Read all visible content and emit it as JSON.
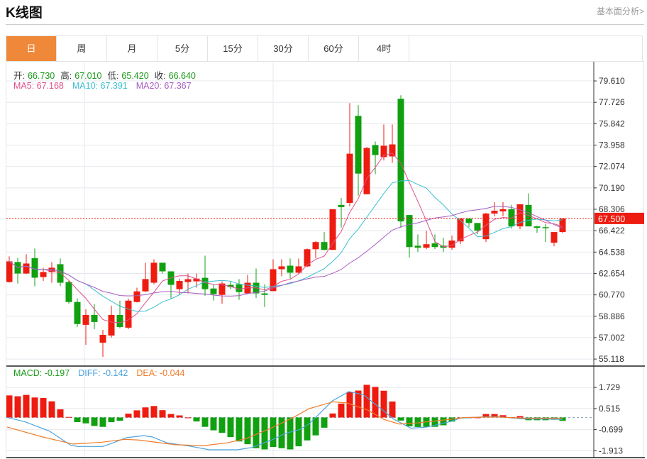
{
  "header": {
    "title": "K线图",
    "more_link": "基本面分析>"
  },
  "tabs": [
    {
      "label": "日",
      "active": true
    },
    {
      "label": "周"
    },
    {
      "label": "月"
    },
    {
      "label": "5分"
    },
    {
      "label": "15分"
    },
    {
      "label": "30分"
    },
    {
      "label": "60分"
    },
    {
      "label": "4时"
    }
  ],
  "ohlc_legend": {
    "open_label": "开:",
    "open": "66.730",
    "high_label": "高:",
    "high": "67.010",
    "low_label": "低:",
    "low": "65.420",
    "close_label": "收:",
    "close": "66.640"
  },
  "ma_legend": {
    "ma5": "MA5: 67.168",
    "ma10": "MA10: 67.391",
    "ma20": "MA20: 67.367"
  },
  "macd_legend": {
    "macd": "MACD: -0.197",
    "diff": "DIFF: -0.142",
    "dea": "DEA: -0.044"
  },
  "current_price": "67.500",
  "colors": {
    "up": "#ee1c10",
    "down": "#10a010",
    "accent": "#f0883a",
    "ma5": "#e0508a",
    "ma10": "#3bbfd0",
    "ma20": "#a85cc0",
    "diff": "#4aa3df",
    "dea": "#f07c2a",
    "macd_text": "#1a9a1a"
  },
  "chart_data": [
    {
      "type": "candlestick",
      "ylim": [
        54.5,
        81.3
      ],
      "y_ticks": [
        "79.610",
        "77.726",
        "75.842",
        "73.958",
        "72.074",
        "70.190",
        "68.306",
        "66.422",
        "64.538",
        "62.654",
        "60.770",
        "58.886",
        "57.002",
        "55.118"
      ],
      "grid": true,
      "current_price_line": 67.5,
      "ohlc": [
        [
          61.9,
          64.16,
          61.85,
          63.72
        ],
        [
          63.66,
          64.03,
          61.77,
          62.65
        ],
        [
          62.65,
          64.35,
          62.6,
          63.53
        ],
        [
          64.0,
          64.85,
          61.53,
          62.28
        ],
        [
          62.34,
          63.16,
          62.0,
          62.78
        ],
        [
          62.78,
          63.66,
          61.84,
          63.16
        ],
        [
          63.47,
          63.97,
          61.53,
          61.84
        ],
        [
          61.9,
          62.03,
          60.0,
          60.14
        ],
        [
          60.14,
          60.45,
          57.95,
          58.2
        ],
        [
          58.13,
          59.5,
          56.37,
          59.0
        ],
        [
          59.0,
          59.95,
          57.75,
          58.38
        ],
        [
          56.56,
          57.69,
          55.31,
          57.25
        ],
        [
          57.19,
          59.82,
          57.0,
          59.0
        ],
        [
          59.0,
          60.26,
          57.82,
          57.94
        ],
        [
          57.88,
          60.45,
          57.75,
          60.26
        ],
        [
          60.14,
          61.4,
          60.1,
          61.08
        ],
        [
          61.08,
          63.6,
          61.0,
          62.16
        ],
        [
          61.84,
          63.9,
          61.7,
          63.6
        ],
        [
          63.6,
          63.6,
          62.65,
          62.84
        ],
        [
          62.84,
          62.84,
          60.45,
          61.65
        ],
        [
          61.27,
          62.2,
          60.77,
          62.0
        ],
        [
          61.9,
          62.65,
          60.9,
          62.15
        ],
        [
          61.96,
          62.65,
          61.4,
          62.2
        ],
        [
          62.27,
          64.22,
          60.7,
          61.27
        ],
        [
          61.33,
          61.65,
          60.27,
          60.83
        ],
        [
          60.77,
          61.96,
          60.0,
          61.77
        ],
        [
          61.65,
          61.96,
          61.27,
          61.46
        ],
        [
          61.71,
          62.15,
          60.33,
          61.02
        ],
        [
          60.9,
          62.53,
          60.83,
          61.84
        ],
        [
          61.84,
          63.09,
          60.5,
          60.9
        ],
        [
          60.9,
          61.7,
          59.7,
          60.77
        ],
        [
          61.1,
          63.9,
          61.1,
          63.03
        ],
        [
          63.03,
          63.9,
          62.4,
          63.28
        ],
        [
          63.34,
          63.97,
          62.2,
          62.72
        ],
        [
          62.72,
          63.97,
          62.6,
          63.28
        ],
        [
          63.28,
          64.85,
          63.2,
          64.79
        ],
        [
          64.79,
          65.5,
          64.0,
          65.42
        ],
        [
          65.42,
          66.3,
          64.7,
          64.73
        ],
        [
          64.73,
          68.31,
          64.73,
          68.31
        ],
        [
          68.69,
          69.3,
          66.7,
          68.5
        ],
        [
          68.87,
          77.66,
          68.56,
          73.2
        ],
        [
          76.53,
          77.47,
          69.5,
          71.45
        ],
        [
          69.63,
          73.8,
          69.63,
          73.7
        ],
        [
          73.96,
          74.27,
          71.4,
          73.08
        ],
        [
          72.9,
          75.78,
          72.6,
          73.9
        ],
        [
          72.96,
          75.78,
          72.4,
          74.02
        ],
        [
          78.04,
          78.35,
          66.67,
          67.24
        ],
        [
          67.8,
          67.8,
          64.04,
          64.98
        ],
        [
          65.1,
          66.1,
          64.54,
          64.92
        ],
        [
          64.92,
          66.42,
          64.8,
          65.23
        ],
        [
          65.3,
          66.1,
          64.8,
          64.98
        ],
        [
          65.1,
          65.8,
          64.54,
          64.92
        ],
        [
          64.92,
          65.99,
          64.73,
          65.55
        ],
        [
          65.48,
          67.5,
          65.23,
          67.49
        ],
        [
          67.49,
          67.5,
          66.73,
          67.1
        ],
        [
          67.1,
          67.1,
          66.1,
          66.42
        ],
        [
          65.67,
          68.0,
          65.42,
          67.93
        ],
        [
          67.93,
          68.94,
          67.68,
          68.18
        ],
        [
          68.12,
          68.94,
          67.68,
          68.31
        ],
        [
          68.31,
          68.7,
          66.6,
          66.8
        ],
        [
          66.8,
          68.75,
          66.55,
          68.75
        ],
        [
          68.69,
          69.7,
          66.8,
          66.8
        ],
        [
          66.8,
          66.86,
          66.23,
          66.67
        ],
        [
          66.73,
          67.01,
          65.42,
          66.64
        ],
        [
          65.36,
          66.3,
          65.04,
          66.3
        ],
        [
          66.3,
          67.5,
          66.23,
          67.5
        ]
      ],
      "series": [
        {
          "name": "MA5",
          "period": 5
        },
        {
          "name": "MA10",
          "period": 10
        },
        {
          "name": "MA20",
          "period": 20
        }
      ]
    },
    {
      "type": "bar+line",
      "ylim": [
        -2.31,
        2.96
      ],
      "y_ticks": [
        "1.729",
        "0.515",
        "-0.699",
        "-1.913"
      ],
      "macd": [
        1.27,
        1.22,
        1.3,
        1.15,
        1.12,
        0.93,
        0.47,
        0.03,
        -0.27,
        -0.34,
        -0.49,
        -0.54,
        -0.27,
        -0.19,
        0.22,
        0.41,
        0.58,
        0.66,
        0.42,
        0.2,
        0.12,
        0.0,
        -0.23,
        -0.54,
        -0.74,
        -0.88,
        -1.13,
        -1.38,
        -1.54,
        -1.77,
        -1.84,
        -1.7,
        -1.77,
        -1.84,
        -1.66,
        -1.32,
        -1.03,
        -0.59,
        0.23,
        0.8,
        1.47,
        1.55,
        1.88,
        1.76,
        1.54,
        0.92,
        -0.18,
        -0.51,
        -0.55,
        -0.54,
        -0.54,
        -0.45,
        -0.24,
        0.0,
        0.0,
        0.0,
        0.2,
        0.2,
        0.13,
        0.02,
        0.08,
        -0.16,
        -0.16,
        -0.16,
        -0.13,
        -0.197
      ],
      "diff": [
        [
          0.75,
          0.0
        ],
        [
          2.8,
          -0.24
        ],
        [
          5.7,
          -0.78
        ],
        [
          8.2,
          -1.59
        ],
        [
          9,
          -1.67
        ],
        [
          12,
          -1.67
        ],
        [
          13.2,
          -1.46
        ],
        [
          14.8,
          -1.16
        ],
        [
          16.8,
          -1.05
        ],
        [
          17.8,
          -1.12
        ],
        [
          19.5,
          -1.46
        ],
        [
          22.3,
          -1.66
        ],
        [
          24.5,
          -1.86
        ],
        [
          27.8,
          -1.86
        ],
        [
          29.5,
          -1.73
        ],
        [
          32,
          -1.26
        ],
        [
          33.4,
          -0.92
        ],
        [
          35.1,
          -0.7
        ],
        [
          36.2,
          -0.38
        ],
        [
          39,
          0.97
        ],
        [
          40.9,
          1.49
        ],
        [
          42.6,
          1.31
        ],
        [
          44.5,
          0.57
        ],
        [
          46.2,
          -0.11
        ],
        [
          48.2,
          -0.62
        ],
        [
          50.1,
          -0.55
        ],
        [
          52.8,
          -0.24
        ],
        [
          54,
          -0.04
        ],
        [
          56.5,
          0.03
        ],
        [
          58.4,
          0.05
        ],
        [
          61.2,
          -0.08
        ],
        [
          65.3,
          -0.1
        ],
        [
          66,
          -0.142
        ]
      ],
      "dea": [
        [
          0.75,
          -0.55
        ],
        [
          4.9,
          -1.12
        ],
        [
          8.5,
          -1.53
        ],
        [
          11.8,
          -1.43
        ],
        [
          14.6,
          -1.26
        ],
        [
          16.2,
          -1.3
        ],
        [
          20.5,
          -1.57
        ],
        [
          23.9,
          -1.62
        ],
        [
          26.6,
          -1.46
        ],
        [
          28.8,
          -1.22
        ],
        [
          31.6,
          -0.65
        ],
        [
          34.3,
          -0.02
        ],
        [
          36.2,
          0.5
        ],
        [
          39,
          0.9
        ],
        [
          40.6,
          0.84
        ],
        [
          43.1,
          0.43
        ],
        [
          45,
          -0.11
        ],
        [
          46.8,
          -0.38
        ],
        [
          49,
          -0.31
        ],
        [
          52.8,
          -0.11
        ],
        [
          54.5,
          0.0
        ],
        [
          58.4,
          0.03
        ],
        [
          61.2,
          -0.04
        ],
        [
          66,
          -0.044
        ]
      ]
    }
  ]
}
